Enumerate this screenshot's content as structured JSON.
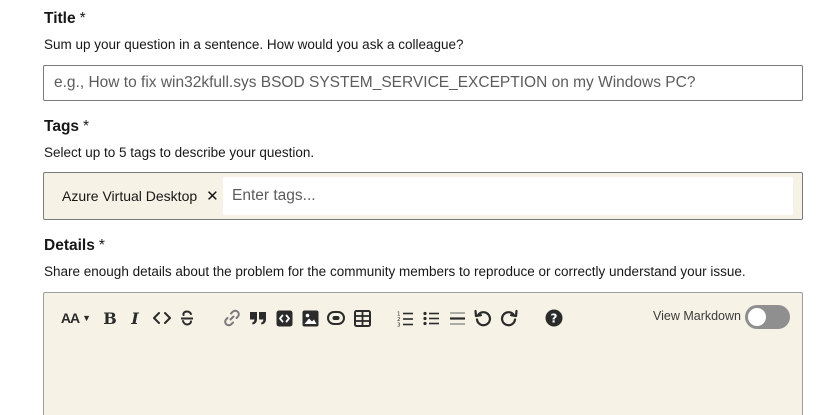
{
  "title_field": {
    "label": "Title",
    "required_mark": "*",
    "help": "Sum up your question in a sentence. How would you ask a colleague?",
    "placeholder": "e.g., How to fix win32kfull.sys BSOD SYSTEM_SERVICE_EXCEPTION on my Windows PC?",
    "value": ""
  },
  "tags_field": {
    "label": "Tags",
    "required_mark": "*",
    "help": "Select up to 5 tags to describe your question.",
    "tags": [
      {
        "label": "Azure Virtual Desktop",
        "remove_glyph": "✕"
      }
    ],
    "placeholder": "Enter tags..."
  },
  "details_field": {
    "label": "Details",
    "required_mark": "*",
    "help": "Share enough details about the problem for the community members to reproduce or correctly understand your issue.",
    "toolbar": {
      "font_size_glyph": "AA",
      "bold_glyph": "B",
      "italic_glyph": "I",
      "icons": [
        "font-size-icon",
        "bold-icon",
        "italic-icon",
        "code-icon",
        "strikethrough-icon",
        "link-icon",
        "quote-icon",
        "code-block-icon",
        "image-icon",
        "mention-icon",
        "table-icon",
        "ordered-list-icon",
        "bullet-list-icon",
        "horizontal-rule-icon",
        "undo-icon",
        "redo-icon",
        "help-icon"
      ],
      "markdown_toggle_label": "View Markdown",
      "markdown_toggle_on": false
    }
  },
  "colors": {
    "text": "#171717",
    "border": "#7a7a7a",
    "editor_background": "#f6f2e6",
    "toggle_off": "#8f8f8f"
  }
}
